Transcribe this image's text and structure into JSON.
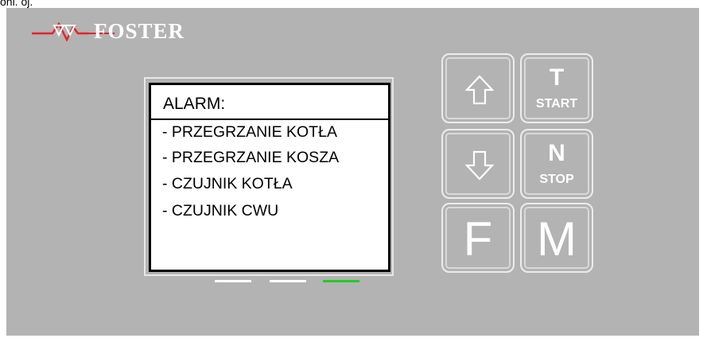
{
  "caption": "onl. oj.",
  "logo": {
    "text": "FOSTER",
    "accent_color": "#e8222a"
  },
  "display": {
    "title": "ALARM:",
    "alarms": [
      "- PRZEGRZANIE KOTŁA",
      "- PRZEGRZANIE KOSZA",
      "- CZUJNIK KOTŁA",
      "- CZUJNIK CWU"
    ]
  },
  "leds": [
    {
      "color": "#ffffff",
      "state": "off"
    },
    {
      "color": "#ffffff",
      "state": "off"
    },
    {
      "color": "#22cc22",
      "state": "on"
    }
  ],
  "buttons": {
    "up": {
      "icon": "arrow-up-icon"
    },
    "down": {
      "icon": "arrow-down-icon"
    },
    "start": {
      "main": "T",
      "sub": "START"
    },
    "stop": {
      "main": "N",
      "sub": "STOP"
    },
    "f": {
      "label": "F"
    },
    "m": {
      "label": "M"
    }
  },
  "colors": {
    "panel": "#b3b3b3",
    "screen_bg": "#ffffff",
    "button_border": "#ececec"
  }
}
